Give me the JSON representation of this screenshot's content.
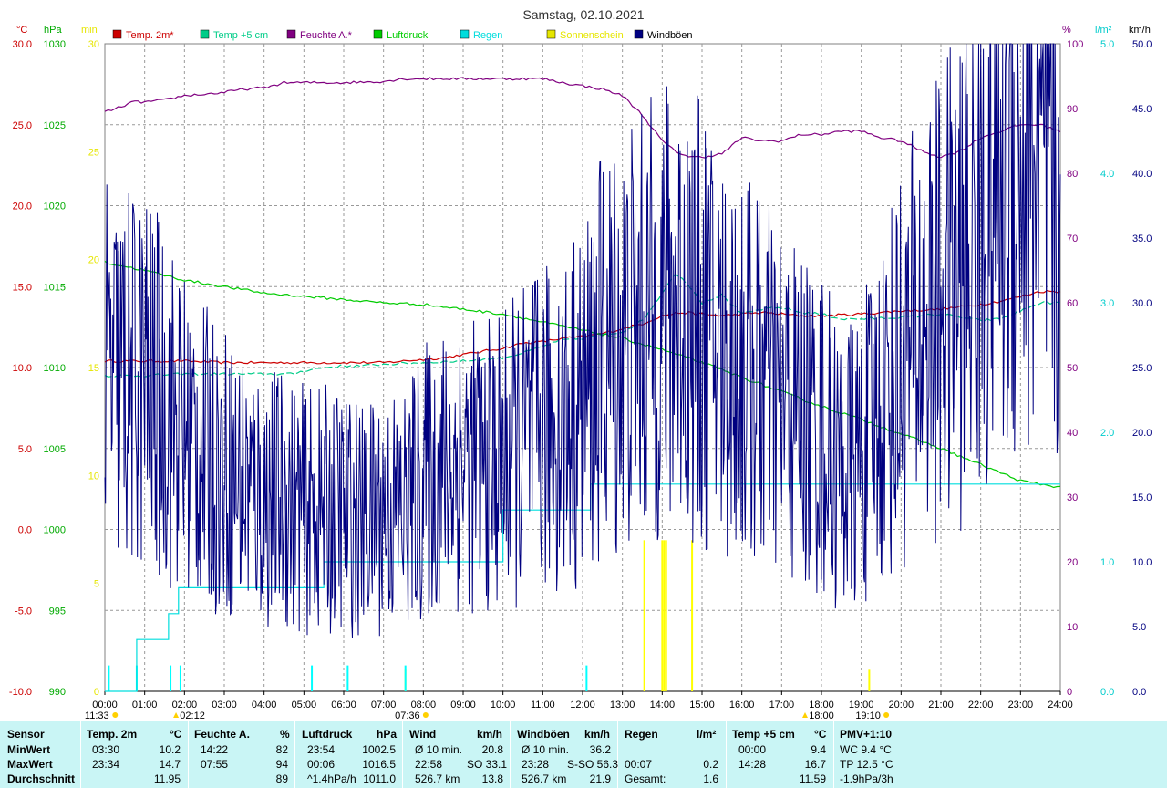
{
  "chart_data": {
    "type": "line",
    "title": "Samstag, 02.10.2021",
    "x_ticks": [
      "00:00",
      "01:00",
      "02:00",
      "03:00",
      "04:00",
      "05:00",
      "06:00",
      "07:00",
      "08:00",
      "09:00",
      "10:00",
      "11:00",
      "12:00",
      "13:00",
      "14:00",
      "15:00",
      "16:00",
      "17:00",
      "18:00",
      "19:00",
      "20:00",
      "21:00",
      "22:00",
      "23:00",
      "24:00"
    ],
    "xlim_hours": [
      0,
      24
    ],
    "axes": {
      "temp": {
        "unit": "°C",
        "min": -10,
        "max": 30,
        "ticks": [
          "-10.0",
          "-5.0",
          "0.0",
          "5.0",
          "10.0",
          "15.0",
          "20.0",
          "25.0",
          "30.0"
        ],
        "color": "#cc0000"
      },
      "pressure": {
        "unit": "hPa",
        "min": 990,
        "max": 1030,
        "ticks": [
          "990",
          "995",
          "1000",
          "1005",
          "1010",
          "1015",
          "1020",
          "1025",
          "1030"
        ],
        "color": "#00aa00"
      },
      "sunshine": {
        "unit": "min",
        "min": 0,
        "max": 30,
        "ticks": [
          "0",
          "5",
          "10",
          "15",
          "20",
          "25",
          "30"
        ],
        "color": "#e6e600"
      },
      "humidity": {
        "unit": "%",
        "min": 0,
        "max": 100,
        "ticks": [
          "0",
          "10",
          "20",
          "30",
          "40",
          "50",
          "60",
          "70",
          "80",
          "90",
          "100"
        ],
        "color": "#800080"
      },
      "rain": {
        "unit": "l/m²",
        "min": 0,
        "max": 5,
        "ticks": [
          "0.0",
          "1.0",
          "2.0",
          "3.0",
          "4.0",
          "5.0"
        ],
        "color": "#00cccc"
      },
      "wind": {
        "unit": "km/h",
        "min": 0,
        "max": 50,
        "ticks": [
          "0.0",
          "5.0",
          "10.0",
          "15.0",
          "20.0",
          "25.0",
          "30.0",
          "35.0",
          "40.0",
          "45.0",
          "50.0"
        ],
        "color": "#000080"
      }
    },
    "legend": [
      {
        "name": "Temp. 2m*",
        "color": "#cc0000"
      },
      {
        "name": "Temp +5 cm",
        "color": "#00cc88"
      },
      {
        "name": "Feuchte A.*",
        "color": "#800080"
      },
      {
        "name": "Luftdruck",
        "color": "#00cc00"
      },
      {
        "name": "Regen",
        "color": "#00dddd"
      },
      {
        "name": "Sonnenschein",
        "color": "#e6e600"
      },
      {
        "name": "Windböen",
        "color": "#000080"
      }
    ],
    "bottom_labels": [
      {
        "text": "11:33",
        "hour": -0.2,
        "icon": "sun"
      },
      {
        "text": "02:12",
        "hour": 2.2,
        "icon": "moon"
      },
      {
        "text": "07:36",
        "hour": 7.6,
        "icon": "sun"
      },
      {
        "text": "18:00",
        "hour": 18.0,
        "icon": "moon"
      },
      {
        "text": "19:10",
        "hour": 19.17,
        "icon": "sun"
      }
    ],
    "series": [
      {
        "name": "Temp. 2m*",
        "axis": "temp",
        "x": [
          0,
          1,
          2,
          3,
          4,
          5,
          6,
          7,
          7.5,
          8,
          8.5,
          9,
          9.5,
          10,
          10.5,
          11,
          11.5,
          12,
          12.5,
          13,
          13.5,
          14,
          14.5,
          15,
          15.5,
          16,
          16.5,
          17,
          17.5,
          18,
          19,
          20,
          21,
          22,
          22.5,
          23,
          23.5,
          24
        ],
        "y": [
          10.4,
          10.4,
          10.4,
          10.3,
          10.3,
          10.3,
          10.3,
          10.3,
          10.4,
          10.5,
          10.6,
          10.8,
          11,
          11.2,
          11.5,
          11.6,
          11.8,
          11.9,
          12.1,
          12.4,
          12.7,
          13.2,
          13.4,
          13.3,
          13.2,
          13.3,
          13.4,
          13.3,
          13.2,
          13.2,
          13.3,
          13.5,
          13.6,
          13.9,
          14.1,
          14.4,
          14.7,
          14.7
        ]
      },
      {
        "name": "Temp +5 cm",
        "axis": "temp",
        "x": [
          0,
          1,
          2,
          3,
          4,
          4.7,
          5,
          5.5,
          6,
          6.5,
          7,
          8,
          9,
          10,
          10.5,
          11,
          11.5,
          12,
          12.5,
          13,
          13.5,
          14,
          14.3,
          14.6,
          15,
          15.5,
          16,
          16.5,
          17,
          17.5,
          18,
          18.5,
          19,
          20,
          21,
          22,
          22.5,
          23,
          23.5,
          24
        ],
        "y": [
          9.5,
          9.5,
          9.6,
          9.6,
          9.6,
          9.6,
          9.8,
          10,
          10.1,
          10.1,
          10.2,
          10.3,
          10.4,
          10.6,
          10.9,
          11.3,
          11.7,
          11.8,
          12.0,
          12.2,
          12.9,
          14.6,
          15.8,
          15.3,
          14.0,
          14.5,
          13.3,
          13.6,
          13.7,
          13.4,
          13.3,
          13.0,
          13.0,
          13.1,
          13.3,
          12.9,
          13.0,
          13.5,
          14.0,
          14.0
        ]
      },
      {
        "name": "Feuchte A.*",
        "axis": "humidity",
        "x": [
          0,
          0.3,
          0.7,
          1,
          1.5,
          2,
          2.5,
          3,
          3.5,
          4,
          4.2,
          4.5,
          5,
          6,
          7,
          7.5,
          8,
          8.5,
          9,
          10,
          11,
          11.5,
          12,
          12.5,
          13,
          13.5,
          14,
          14.3,
          14.7,
          15,
          15.5,
          16,
          16.5,
          17,
          17.5,
          18,
          18.5,
          19,
          19.5,
          20,
          20.5,
          21,
          21.5,
          22,
          22.5,
          23,
          23.5,
          24
        ],
        "y": [
          89.5,
          90,
          91,
          91,
          91.3,
          92,
          92.2,
          92.5,
          93,
          93.2,
          93.5,
          94,
          94,
          94,
          94.2,
          94.6,
          94.6,
          94.6,
          94.6,
          94.6,
          94.6,
          94,
          93.5,
          93,
          92,
          89,
          85,
          83.5,
          82.5,
          82.5,
          83,
          85.5,
          85,
          85,
          86,
          86,
          86.5,
          86.5,
          85.5,
          85,
          83.5,
          82.5,
          83.5,
          85.5,
          86.5,
          87.5,
          87.5,
          86.5
        ]
      },
      {
        "name": "Luftdruck",
        "axis": "pressure",
        "x": [
          0,
          1,
          2,
          3,
          4,
          5,
          6,
          7,
          8,
          9,
          10,
          11,
          12,
          13,
          14,
          15,
          16,
          17,
          18,
          19,
          20,
          21,
          22,
          23,
          24
        ],
        "y": [
          1016.5,
          1016.0,
          1015.4,
          1015.0,
          1014.6,
          1014.4,
          1014.2,
          1014.0,
          1013.9,
          1013.6,
          1013.3,
          1012.8,
          1012.3,
          1011.8,
          1011.1,
          1010.3,
          1009.4,
          1008.5,
          1007.6,
          1006.8,
          1005.9,
          1005.0,
          1004.0,
          1003.0,
          1002.6
        ]
      },
      {
        "name": "Regen",
        "axis": "rain",
        "step": true,
        "x": [
          0,
          0.8,
          1.6,
          1.85,
          2.1,
          5.2,
          5.5,
          7.6,
          10.0,
          12.0,
          12.2,
          16.0,
          18.0,
          24
        ],
        "y": [
          0,
          0.4,
          0.6,
          0.8,
          0.8,
          0.8,
          1.0,
          1.0,
          1.4,
          1.4,
          1.6,
          1.6,
          1.6,
          1.6
        ]
      },
      {
        "name": "Windböen",
        "axis": "wind",
        "noisy": true,
        "x": [
          0,
          1,
          1.5,
          2,
          2.5,
          3,
          3.5,
          4,
          4.5,
          5,
          5.5,
          6,
          6.5,
          7,
          7.5,
          8,
          8.5,
          9,
          9.5,
          10,
          10.5,
          11,
          11.5,
          12,
          12.5,
          13,
          13.5,
          14,
          14.5,
          15,
          15.5,
          16,
          16.5,
          17,
          17.5,
          18,
          18.5,
          19,
          19.5,
          20,
          20.5,
          21,
          21.5,
          22,
          22.5,
          23,
          23.5,
          24
        ],
        "y": [
          24,
          24,
          22,
          20,
          18,
          17,
          16,
          15,
          15,
          14,
          14,
          14,
          13,
          14,
          14,
          16,
          17,
          18,
          17,
          18,
          19,
          20,
          21,
          22,
          26,
          27,
          28,
          29,
          30,
          28,
          26,
          25,
          24,
          22,
          21,
          20,
          17,
          18,
          22,
          25,
          28,
          30,
          32,
          36,
          40,
          42,
          40,
          37
        ]
      }
    ],
    "rain_bars_hours": [
      0.1,
      0.8,
      1.65,
      1.9,
      5.2,
      6.1,
      7.55,
      12.1
    ],
    "rain_bar_value": 0.2,
    "sun_bars_hours": [
      7.55,
      13.55,
      14.0,
      14.05,
      14.1,
      14.75,
      19.2
    ],
    "sun_bar_values": [
      1,
      7,
      7,
      7,
      7,
      7,
      1
    ]
  },
  "stats": {
    "headers": {
      "sensor": "Sensor",
      "temp": "Temp. 2m",
      "temp_unit": "°C",
      "hum": "Feuchte A.",
      "hum_unit": "%",
      "press": "Luftdruck",
      "press_unit": "hPa",
      "wind": "Wind",
      "wind_unit": "km/h",
      "gust": "Windböen",
      "gust_unit": "km/h",
      "rain": "Regen",
      "rain_unit": "l/m²",
      "t5": "Temp +5 cm",
      "t5_unit": "°C",
      "pmv": "PMV+1:10"
    },
    "rows": [
      {
        "label": "MinWert",
        "temp_t": "03:30",
        "temp_v": "10.2",
        "hum_t": "14:22",
        "hum_v": "82",
        "press_t": "23:54",
        "press_v": "1002.5",
        "wind_a": "Ø 10 min.",
        "wind_v": "20.8",
        "gust_a": "Ø 10 min.",
        "gust_v": "36.2",
        "rain_t": "",
        "rain_v": "",
        "t5_t": "00:00",
        "t5_v": "9.4",
        "pmv": "WC 9.4 °C"
      },
      {
        "label": "MaxWert",
        "temp_t": "23:34",
        "temp_v": "14.7",
        "hum_t": "07:55",
        "hum_v": "94",
        "press_t": "00:06",
        "press_v": "1016.5",
        "wind_a": "22:58",
        "wind_b": "SO 33.1",
        "gust_a": "23:28",
        "gust_b": "S-SO 56.3",
        "rain_t": "00:07",
        "rain_v": "0.2",
        "t5_t": "14:28",
        "t5_v": "16.7",
        "pmv": "TP 12.5 °C"
      },
      {
        "label": "Durchschnitt",
        "temp_t": "",
        "temp_v": "11.95",
        "hum_t": "",
        "hum_v": "89",
        "press_t": "^1.4hPa/h",
        "press_v": "1011.0",
        "wind_a": "526.7 km",
        "wind_v": "13.8",
        "gust_a": "526.7 km",
        "gust_v": "21.9",
        "rain_t": "Gesamt:",
        "rain_v": "1.6",
        "t5_t": "",
        "t5_v": "11.59",
        "pmv": "-1.9hPa/3h"
      }
    ]
  }
}
